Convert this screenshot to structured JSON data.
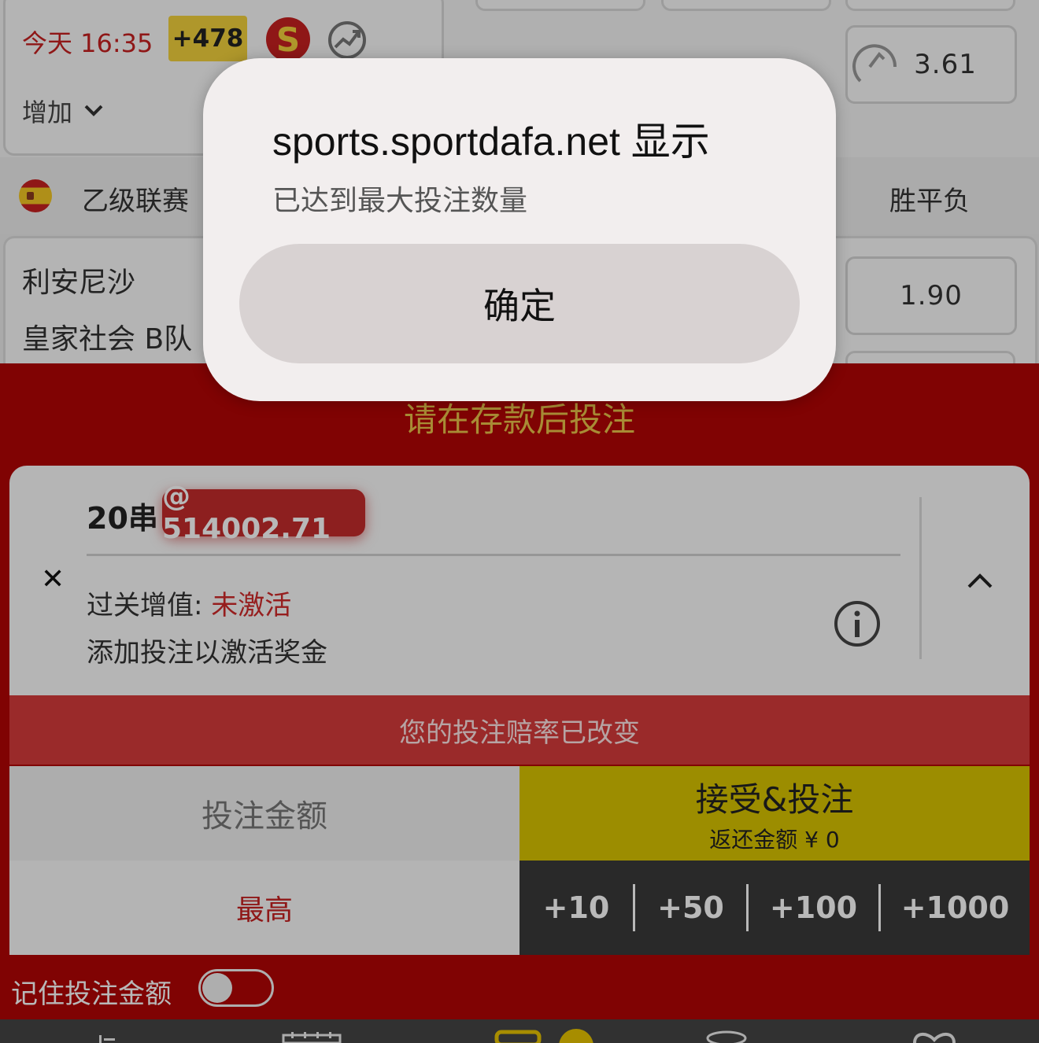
{
  "match": {
    "time": "今天 16:35",
    "goal_badge": "+478",
    "live_icon_letter": "S",
    "more_label": "增加",
    "boost_odds": "3.61",
    "odds_home": "1.90"
  },
  "league": {
    "name": "乙级联赛",
    "market": "胜平负",
    "flag": "spain-flag-icon"
  },
  "teams": {
    "home": "利安尼沙",
    "away": "皇家社会 B队"
  },
  "slip": {
    "deposit_hint": "请在存款后投注",
    "parlay_label": "20串",
    "parlay_odds": "@ 514002.71",
    "boost_label": "过关增值: ",
    "boost_status": "未激活",
    "boost_hint": "添加投注以激活奖金",
    "odds_changed": "您的投注赔率已改变",
    "stake_placeholder": "投注金额",
    "accept_label": "接受&投注",
    "return_label": "返还金额 ¥ 0",
    "max_label": "最高",
    "quick_amounts": [
      "+10",
      "+50",
      "+100",
      "+1000"
    ],
    "remember_label": "记住投注金额",
    "remember_enabled": false
  },
  "dialog": {
    "title": "sports.sportdafa.net 显示",
    "message": "已达到最大投注数量",
    "ok_label": "确定"
  },
  "colors": {
    "slip_red": "#b20505",
    "accent_yellow": "#d9c400",
    "odds_pill": "#c42b2b",
    "live_red": "#c62020"
  }
}
